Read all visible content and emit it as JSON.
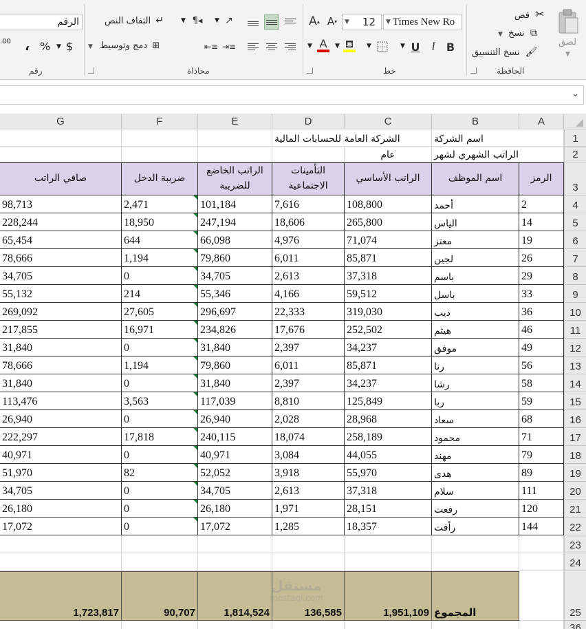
{
  "ribbon": {
    "clipboard": {
      "label": "الحافظة",
      "paste": "لصق",
      "cut": "قص",
      "copy": "نسخ",
      "format_painter": "نسخ التنسيق"
    },
    "font": {
      "label": "خط",
      "font_name": "Times New Ro",
      "font_size": "12",
      "grow_font": "A",
      "shrink_font": "A",
      "bold": "B",
      "italic": "I",
      "underline": "U",
      "font_color_letter": "A"
    },
    "alignment": {
      "label": "محاذاة",
      "wrap_text": "التفاف النص",
      "merge_center": "دمج وتوسيط"
    },
    "number": {
      "label": "رقم",
      "format": "الرقم",
      "currency": "$",
      "percent": "%",
      "comma": "،",
      "decimals": ".00"
    }
  },
  "formula_bar": {
    "content": ""
  },
  "columns": [
    "A",
    "B",
    "C",
    "D",
    "E",
    "F",
    "G"
  ],
  "sheet": {
    "company_label": "اسم الشركة",
    "company_name": "الشركة العامة للحسابات المالية",
    "salary_label": "الراتب الشهري لشهر",
    "salary_year": "عام",
    "headers": {
      "code": "الرمز",
      "name": "اسم الموظف",
      "basic": "الراتب الأساسي",
      "insurance": "التأمينات الاجتماعية",
      "taxable": "الراتب الخاضع للضريبة",
      "tax": "ضريبة الدخل",
      "net": "صافي الراتب"
    },
    "rows": [
      {
        "rownum": "4",
        "code": "2",
        "name": "أحمد",
        "basic": "108,800",
        "insurance": "7,616",
        "taxable": "101,184",
        "tax": "2,471",
        "net": "98,713"
      },
      {
        "rownum": "5",
        "code": "14",
        "name": "الياس",
        "basic": "265,800",
        "insurance": "18,606",
        "taxable": "247,194",
        "tax": "18,950",
        "net": "228,244"
      },
      {
        "rownum": "6",
        "code": "19",
        "name": "معتز",
        "basic": "71,074",
        "insurance": "4,976",
        "taxable": "66,098",
        "tax": "644",
        "net": "65,454"
      },
      {
        "rownum": "7",
        "code": "26",
        "name": "لجين",
        "basic": "85,871",
        "insurance": "6,011",
        "taxable": "79,860",
        "tax": "1,194",
        "net": "78,666"
      },
      {
        "rownum": "8",
        "code": "29",
        "name": "باسم",
        "basic": "37,318",
        "insurance": "2,613",
        "taxable": "34,705",
        "tax": "0",
        "net": "34,705"
      },
      {
        "rownum": "9",
        "code": "33",
        "name": "باسل",
        "basic": "59,512",
        "insurance": "4,166",
        "taxable": "55,346",
        "tax": "214",
        "net": "55,132"
      },
      {
        "rownum": "10",
        "code": "36",
        "name": "ديب",
        "basic": "319,030",
        "insurance": "22,333",
        "taxable": "296,697",
        "tax": "27,605",
        "net": "269,092"
      },
      {
        "rownum": "11",
        "code": "46",
        "name": "هيثم",
        "basic": "252,502",
        "insurance": "17,676",
        "taxable": "234,826",
        "tax": "16,971",
        "net": "217,855"
      },
      {
        "rownum": "12",
        "code": "49",
        "name": "موفق",
        "basic": "34,237",
        "insurance": "2,397",
        "taxable": "31,840",
        "tax": "0",
        "net": "31,840"
      },
      {
        "rownum": "13",
        "code": "56",
        "name": "رنا",
        "basic": "85,871",
        "insurance": "6,011",
        "taxable": "79,860",
        "tax": "1,194",
        "net": "78,666"
      },
      {
        "rownum": "14",
        "code": "58",
        "name": "رشا",
        "basic": "34,237",
        "insurance": "2,397",
        "taxable": "31,840",
        "tax": "0",
        "net": "31,840"
      },
      {
        "rownum": "15",
        "code": "59",
        "name": "ربا",
        "basic": "125,849",
        "insurance": "8,810",
        "taxable": "117,039",
        "tax": "3,563",
        "net": "113,476"
      },
      {
        "rownum": "16",
        "code": "68",
        "name": "سعاد",
        "basic": "28,968",
        "insurance": "2,028",
        "taxable": "26,940",
        "tax": "0",
        "net": "26,940"
      },
      {
        "rownum": "17",
        "code": "71",
        "name": "محمود",
        "basic": "258,189",
        "insurance": "18,074",
        "taxable": "240,115",
        "tax": "17,818",
        "net": "222,297"
      },
      {
        "rownum": "18",
        "code": "79",
        "name": "مهند",
        "basic": "44,055",
        "insurance": "3,084",
        "taxable": "40,971",
        "tax": "0",
        "net": "40,971"
      },
      {
        "rownum": "19",
        "code": "89",
        "name": "هدى",
        "basic": "55,970",
        "insurance": "3,918",
        "taxable": "52,052",
        "tax": "82",
        "net": "51,970"
      },
      {
        "rownum": "20",
        "code": "111",
        "name": "سلام",
        "basic": "37,318",
        "insurance": "2,613",
        "taxable": "34,705",
        "tax": "0",
        "net": "34,705"
      },
      {
        "rownum": "21",
        "code": "120",
        "name": "رفعت",
        "basic": "28,151",
        "insurance": "1,971",
        "taxable": "26,180",
        "tax": "0",
        "net": "26,180"
      },
      {
        "rownum": "22",
        "code": "144",
        "name": "رأفت",
        "basic": "18,357",
        "insurance": "1,285",
        "taxable": "17,072",
        "tax": "0",
        "net": "17,072"
      }
    ],
    "totals": {
      "label": "المجموع",
      "basic": "1,951,109",
      "insurance": "136,585",
      "taxable": "1,814,524",
      "tax": "90,707",
      "net": "1,723,817"
    },
    "row_numbers": {
      "r1": "1",
      "r2": "2",
      "r3": "3",
      "r23": "23",
      "r24": "24",
      "r25": "25",
      "r36": "36"
    }
  },
  "watermark": {
    "big": "مستقل",
    "small": "mostaql.com"
  },
  "colors": {
    "header_fill": "#d9d2e9",
    "total_fill": "#c5bc96",
    "accent": "#217346",
    "font_color": "#e00000",
    "highlight": "#ffff00"
  }
}
